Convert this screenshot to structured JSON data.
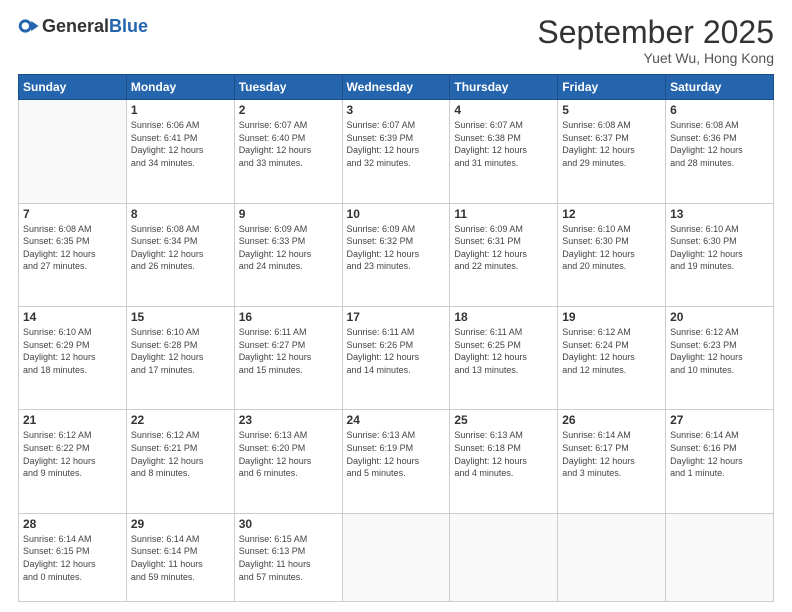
{
  "header": {
    "logo_general": "General",
    "logo_blue": "Blue",
    "month_title": "September 2025",
    "subtitle": "Yuet Wu, Hong Kong"
  },
  "weekdays": [
    "Sunday",
    "Monday",
    "Tuesday",
    "Wednesday",
    "Thursday",
    "Friday",
    "Saturday"
  ],
  "rows": [
    [
      {
        "day": "",
        "info": ""
      },
      {
        "day": "1",
        "info": "Sunrise: 6:06 AM\nSunset: 6:41 PM\nDaylight: 12 hours\nand 34 minutes."
      },
      {
        "day": "2",
        "info": "Sunrise: 6:07 AM\nSunset: 6:40 PM\nDaylight: 12 hours\nand 33 minutes."
      },
      {
        "day": "3",
        "info": "Sunrise: 6:07 AM\nSunset: 6:39 PM\nDaylight: 12 hours\nand 32 minutes."
      },
      {
        "day": "4",
        "info": "Sunrise: 6:07 AM\nSunset: 6:38 PM\nDaylight: 12 hours\nand 31 minutes."
      },
      {
        "day": "5",
        "info": "Sunrise: 6:08 AM\nSunset: 6:37 PM\nDaylight: 12 hours\nand 29 minutes."
      },
      {
        "day": "6",
        "info": "Sunrise: 6:08 AM\nSunset: 6:36 PM\nDaylight: 12 hours\nand 28 minutes."
      }
    ],
    [
      {
        "day": "7",
        "info": "Sunrise: 6:08 AM\nSunset: 6:35 PM\nDaylight: 12 hours\nand 27 minutes."
      },
      {
        "day": "8",
        "info": "Sunrise: 6:08 AM\nSunset: 6:34 PM\nDaylight: 12 hours\nand 26 minutes."
      },
      {
        "day": "9",
        "info": "Sunrise: 6:09 AM\nSunset: 6:33 PM\nDaylight: 12 hours\nand 24 minutes."
      },
      {
        "day": "10",
        "info": "Sunrise: 6:09 AM\nSunset: 6:32 PM\nDaylight: 12 hours\nand 23 minutes."
      },
      {
        "day": "11",
        "info": "Sunrise: 6:09 AM\nSunset: 6:31 PM\nDaylight: 12 hours\nand 22 minutes."
      },
      {
        "day": "12",
        "info": "Sunrise: 6:10 AM\nSunset: 6:30 PM\nDaylight: 12 hours\nand 20 minutes."
      },
      {
        "day": "13",
        "info": "Sunrise: 6:10 AM\nSunset: 6:30 PM\nDaylight: 12 hours\nand 19 minutes."
      }
    ],
    [
      {
        "day": "14",
        "info": "Sunrise: 6:10 AM\nSunset: 6:29 PM\nDaylight: 12 hours\nand 18 minutes."
      },
      {
        "day": "15",
        "info": "Sunrise: 6:10 AM\nSunset: 6:28 PM\nDaylight: 12 hours\nand 17 minutes."
      },
      {
        "day": "16",
        "info": "Sunrise: 6:11 AM\nSunset: 6:27 PM\nDaylight: 12 hours\nand 15 minutes."
      },
      {
        "day": "17",
        "info": "Sunrise: 6:11 AM\nSunset: 6:26 PM\nDaylight: 12 hours\nand 14 minutes."
      },
      {
        "day": "18",
        "info": "Sunrise: 6:11 AM\nSunset: 6:25 PM\nDaylight: 12 hours\nand 13 minutes."
      },
      {
        "day": "19",
        "info": "Sunrise: 6:12 AM\nSunset: 6:24 PM\nDaylight: 12 hours\nand 12 minutes."
      },
      {
        "day": "20",
        "info": "Sunrise: 6:12 AM\nSunset: 6:23 PM\nDaylight: 12 hours\nand 10 minutes."
      }
    ],
    [
      {
        "day": "21",
        "info": "Sunrise: 6:12 AM\nSunset: 6:22 PM\nDaylight: 12 hours\nand 9 minutes."
      },
      {
        "day": "22",
        "info": "Sunrise: 6:12 AM\nSunset: 6:21 PM\nDaylight: 12 hours\nand 8 minutes."
      },
      {
        "day": "23",
        "info": "Sunrise: 6:13 AM\nSunset: 6:20 PM\nDaylight: 12 hours\nand 6 minutes."
      },
      {
        "day": "24",
        "info": "Sunrise: 6:13 AM\nSunset: 6:19 PM\nDaylight: 12 hours\nand 5 minutes."
      },
      {
        "day": "25",
        "info": "Sunrise: 6:13 AM\nSunset: 6:18 PM\nDaylight: 12 hours\nand 4 minutes."
      },
      {
        "day": "26",
        "info": "Sunrise: 6:14 AM\nSunset: 6:17 PM\nDaylight: 12 hours\nand 3 minutes."
      },
      {
        "day": "27",
        "info": "Sunrise: 6:14 AM\nSunset: 6:16 PM\nDaylight: 12 hours\nand 1 minute."
      }
    ],
    [
      {
        "day": "28",
        "info": "Sunrise: 6:14 AM\nSunset: 6:15 PM\nDaylight: 12 hours\nand 0 minutes."
      },
      {
        "day": "29",
        "info": "Sunrise: 6:14 AM\nSunset: 6:14 PM\nDaylight: 11 hours\nand 59 minutes."
      },
      {
        "day": "30",
        "info": "Sunrise: 6:15 AM\nSunset: 6:13 PM\nDaylight: 11 hours\nand 57 minutes."
      },
      {
        "day": "",
        "info": ""
      },
      {
        "day": "",
        "info": ""
      },
      {
        "day": "",
        "info": ""
      },
      {
        "day": "",
        "info": ""
      }
    ]
  ]
}
